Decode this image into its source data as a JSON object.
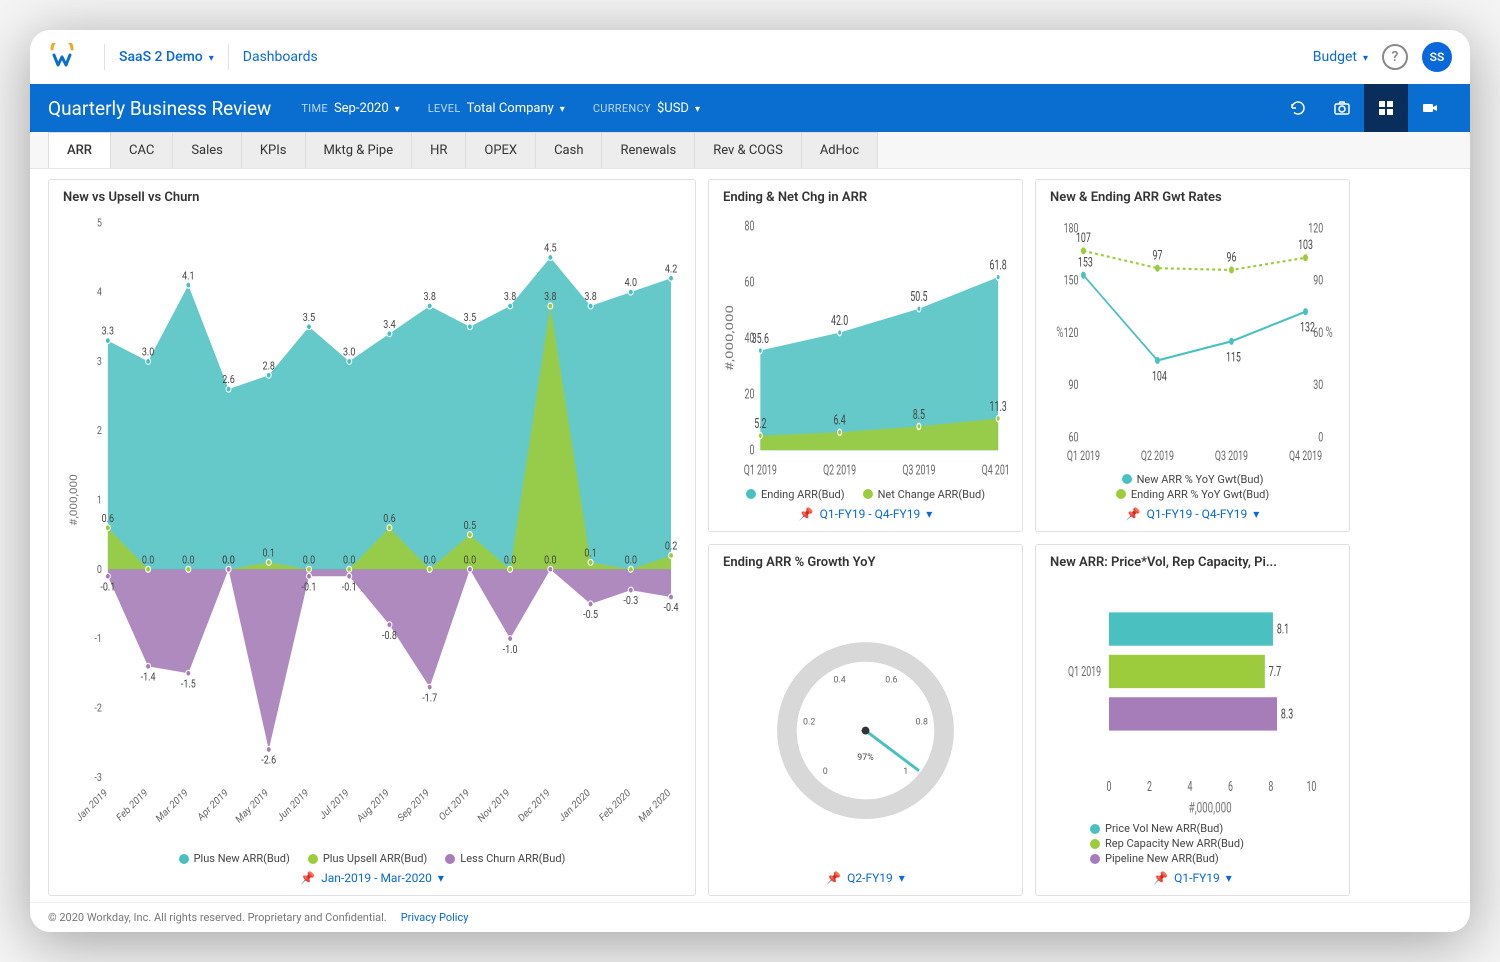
{
  "header": {
    "tenant": "SaaS 2 Demo",
    "breadcrumb": "Dashboards",
    "budget": "Budget",
    "avatar": "SS"
  },
  "bluebar": {
    "title": "Quarterly Business Review",
    "time_label": "TIME",
    "time_value": "Sep-2020",
    "level_label": "LEVEL",
    "level_value": "Total Company",
    "currency_label": "CURRENCY",
    "currency_value": "$USD"
  },
  "tabs": [
    "ARR",
    "CAC",
    "Sales",
    "KPIs",
    "Mktg & Pipe",
    "HR",
    "OPEX",
    "Cash",
    "Renewals",
    "Rev & COGS",
    "AdHoc"
  ],
  "active_tab": "ARR",
  "cards": {
    "big": {
      "title": "New vs Upsell vs Churn",
      "legend": [
        "Plus New ARR(Bud)",
        "Plus Upsell ARR(Bud)",
        "Less Churn ARR(Bud)"
      ],
      "range": "Jan-2019 - Mar-2020",
      "ylabel": "#,000,000"
    },
    "ending_net": {
      "title": "Ending & Net Chg in ARR",
      "legend": [
        "Ending ARR(Bud)",
        "Net Change ARR(Bud)"
      ],
      "range": "Q1-FY19 - Q4-FY19",
      "ylabel": "#,000,000"
    },
    "gwt_rates": {
      "title": "New & Ending ARR Gwt Rates",
      "legend": [
        "New ARR % YoY Gwt(Bud)",
        "Ending ARR % YoY Gwt(Bud)"
      ],
      "range": "Q1-FY19 - Q4-FY19"
    },
    "gauge": {
      "title": "Ending ARR % Growth YoY",
      "value_text": "97%",
      "range": "Q2-FY19"
    },
    "bars": {
      "title": "New ARR: Price*Vol, Rep Capacity, Pi...",
      "legend": [
        "Price Vol New ARR(Bud)",
        "Rep Capacity New ARR(Bud)",
        "Pipeline New ARR(Bud)"
      ],
      "range": "Q1-FY19",
      "xlabel": "#,000,000",
      "category": "Q1 2019"
    }
  },
  "footer": {
    "copyright": "© 2020 Workday, Inc. All rights reserved. Proprietary and Confidential.",
    "privacy": "Privacy Policy"
  },
  "chart_data": [
    {
      "id": "new_upsell_churn",
      "type": "area",
      "title": "New vs Upsell vs Churn",
      "ylabel": "#,000,000",
      "ylim": [
        -3,
        5
      ],
      "categories": [
        "Jan 2019",
        "Feb 2019",
        "Mar 2019",
        "Apr 2019",
        "May 2019",
        "Jun 2019",
        "Jul 2019",
        "Aug 2019",
        "Sep 2019",
        "Oct 2019",
        "Nov 2019",
        "Dec 2019",
        "Jan 2020",
        "Feb 2020",
        "Mar 2020"
      ],
      "series": [
        {
          "name": "Plus New ARR(Bud)",
          "color": "#4bc0c0",
          "values": [
            3.3,
            3.0,
            4.1,
            2.6,
            2.8,
            3.5,
            3.0,
            3.4,
            3.8,
            3.5,
            3.8,
            4.5,
            3.8,
            4.0,
            4.2
          ]
        },
        {
          "name": "Plus Upsell ARR(Bud)",
          "color": "#9ccc3c",
          "values": [
            0.6,
            0.0,
            0.0,
            0.0,
            0.1,
            0.0,
            0.0,
            0.6,
            0.0,
            0.5,
            0.0,
            3.8,
            0.1,
            0.0,
            0.2
          ]
        },
        {
          "name": "Less Churn ARR(Bud)",
          "color": "#a67db8",
          "values": [
            -0.1,
            -1.4,
            -1.5,
            -0.0,
            -2.6,
            -0.1,
            -0.1,
            -0.8,
            -1.7,
            -0.0,
            -1.0,
            -0.0,
            -0.5,
            -0.3,
            -0.4
          ]
        }
      ]
    },
    {
      "id": "ending_net_chg",
      "type": "area",
      "title": "Ending & Net Chg in ARR",
      "ylabel": "#,000,000",
      "ylim": [
        0,
        80
      ],
      "categories": [
        "Q1 2019",
        "Q2 2019",
        "Q3 2019",
        "Q4 2019"
      ],
      "series": [
        {
          "name": "Ending ARR(Bud)",
          "color": "#4bc0c0",
          "values": [
            35.6,
            42.0,
            50.5,
            61.8
          ]
        },
        {
          "name": "Net Change ARR(Bud)",
          "color": "#9ccc3c",
          "values": [
            5.2,
            6.4,
            8.5,
            11.3
          ]
        }
      ]
    },
    {
      "id": "gwt_rates",
      "type": "line",
      "title": "New & Ending ARR Gwt Rates",
      "categories": [
        "Q1 2019",
        "Q2 2019",
        "Q3 2019",
        "Q4 2019"
      ],
      "left_ylim": [
        60,
        180
      ],
      "right_ylim": [
        0,
        120
      ],
      "series": [
        {
          "name": "New ARR % YoY Gwt(Bud)",
          "axis": "left",
          "color": "#4bc0c0",
          "values": [
            153,
            104,
            115,
            132
          ]
        },
        {
          "name": "Ending ARR % YoY Gwt(Bud)",
          "axis": "right",
          "color": "#9ccc3c",
          "values": [
            107,
            97,
            96,
            103
          ]
        }
      ]
    },
    {
      "id": "ending_arr_growth_gauge",
      "type": "gauge",
      "title": "Ending ARR % Growth YoY",
      "value": 0.97,
      "ticks": [
        0,
        0.2,
        0.4,
        0.6,
        0.8,
        1
      ]
    },
    {
      "id": "new_arr_price_vol",
      "type": "bar",
      "orientation": "horizontal",
      "title": "New ARR: Price*Vol, Rep Capacity, Pipeline",
      "xlabel": "#,000,000",
      "xlim": [
        0,
        10
      ],
      "categories": [
        "Q1 2019"
      ],
      "series": [
        {
          "name": "Price Vol New ARR(Bud)",
          "color": "#4bc0c0",
          "values": [
            8.1
          ]
        },
        {
          "name": "Rep Capacity New ARR(Bud)",
          "color": "#9ccc3c",
          "values": [
            7.7
          ]
        },
        {
          "name": "Pipeline New ARR(Bud)",
          "color": "#a67db8",
          "values": [
            8.3
          ]
        }
      ]
    }
  ]
}
